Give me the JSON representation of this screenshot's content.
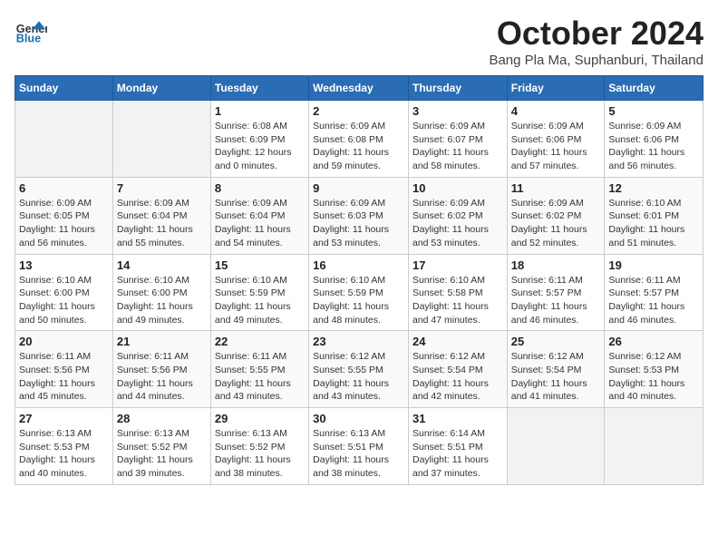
{
  "logo": {
    "general": "General",
    "blue": "Blue"
  },
  "header": {
    "month": "October 2024",
    "location": "Bang Pla Ma, Suphanburi, Thailand"
  },
  "weekdays": [
    "Sunday",
    "Monday",
    "Tuesday",
    "Wednesday",
    "Thursday",
    "Friday",
    "Saturday"
  ],
  "weeks": [
    [
      {
        "day": "",
        "info": ""
      },
      {
        "day": "",
        "info": ""
      },
      {
        "day": "1",
        "info": "Sunrise: 6:08 AM\nSunset: 6:09 PM\nDaylight: 12 hours and 0 minutes."
      },
      {
        "day": "2",
        "info": "Sunrise: 6:09 AM\nSunset: 6:08 PM\nDaylight: 11 hours and 59 minutes."
      },
      {
        "day": "3",
        "info": "Sunrise: 6:09 AM\nSunset: 6:07 PM\nDaylight: 11 hours and 58 minutes."
      },
      {
        "day": "4",
        "info": "Sunrise: 6:09 AM\nSunset: 6:06 PM\nDaylight: 11 hours and 57 minutes."
      },
      {
        "day": "5",
        "info": "Sunrise: 6:09 AM\nSunset: 6:06 PM\nDaylight: 11 hours and 56 minutes."
      }
    ],
    [
      {
        "day": "6",
        "info": "Sunrise: 6:09 AM\nSunset: 6:05 PM\nDaylight: 11 hours and 56 minutes."
      },
      {
        "day": "7",
        "info": "Sunrise: 6:09 AM\nSunset: 6:04 PM\nDaylight: 11 hours and 55 minutes."
      },
      {
        "day": "8",
        "info": "Sunrise: 6:09 AM\nSunset: 6:04 PM\nDaylight: 11 hours and 54 minutes."
      },
      {
        "day": "9",
        "info": "Sunrise: 6:09 AM\nSunset: 6:03 PM\nDaylight: 11 hours and 53 minutes."
      },
      {
        "day": "10",
        "info": "Sunrise: 6:09 AM\nSunset: 6:02 PM\nDaylight: 11 hours and 53 minutes."
      },
      {
        "day": "11",
        "info": "Sunrise: 6:09 AM\nSunset: 6:02 PM\nDaylight: 11 hours and 52 minutes."
      },
      {
        "day": "12",
        "info": "Sunrise: 6:10 AM\nSunset: 6:01 PM\nDaylight: 11 hours and 51 minutes."
      }
    ],
    [
      {
        "day": "13",
        "info": "Sunrise: 6:10 AM\nSunset: 6:00 PM\nDaylight: 11 hours and 50 minutes."
      },
      {
        "day": "14",
        "info": "Sunrise: 6:10 AM\nSunset: 6:00 PM\nDaylight: 11 hours and 49 minutes."
      },
      {
        "day": "15",
        "info": "Sunrise: 6:10 AM\nSunset: 5:59 PM\nDaylight: 11 hours and 49 minutes."
      },
      {
        "day": "16",
        "info": "Sunrise: 6:10 AM\nSunset: 5:59 PM\nDaylight: 11 hours and 48 minutes."
      },
      {
        "day": "17",
        "info": "Sunrise: 6:10 AM\nSunset: 5:58 PM\nDaylight: 11 hours and 47 minutes."
      },
      {
        "day": "18",
        "info": "Sunrise: 6:11 AM\nSunset: 5:57 PM\nDaylight: 11 hours and 46 minutes."
      },
      {
        "day": "19",
        "info": "Sunrise: 6:11 AM\nSunset: 5:57 PM\nDaylight: 11 hours and 46 minutes."
      }
    ],
    [
      {
        "day": "20",
        "info": "Sunrise: 6:11 AM\nSunset: 5:56 PM\nDaylight: 11 hours and 45 minutes."
      },
      {
        "day": "21",
        "info": "Sunrise: 6:11 AM\nSunset: 5:56 PM\nDaylight: 11 hours and 44 minutes."
      },
      {
        "day": "22",
        "info": "Sunrise: 6:11 AM\nSunset: 5:55 PM\nDaylight: 11 hours and 43 minutes."
      },
      {
        "day": "23",
        "info": "Sunrise: 6:12 AM\nSunset: 5:55 PM\nDaylight: 11 hours and 43 minutes."
      },
      {
        "day": "24",
        "info": "Sunrise: 6:12 AM\nSunset: 5:54 PM\nDaylight: 11 hours and 42 minutes."
      },
      {
        "day": "25",
        "info": "Sunrise: 6:12 AM\nSunset: 5:54 PM\nDaylight: 11 hours and 41 minutes."
      },
      {
        "day": "26",
        "info": "Sunrise: 6:12 AM\nSunset: 5:53 PM\nDaylight: 11 hours and 40 minutes."
      }
    ],
    [
      {
        "day": "27",
        "info": "Sunrise: 6:13 AM\nSunset: 5:53 PM\nDaylight: 11 hours and 40 minutes."
      },
      {
        "day": "28",
        "info": "Sunrise: 6:13 AM\nSunset: 5:52 PM\nDaylight: 11 hours and 39 minutes."
      },
      {
        "day": "29",
        "info": "Sunrise: 6:13 AM\nSunset: 5:52 PM\nDaylight: 11 hours and 38 minutes."
      },
      {
        "day": "30",
        "info": "Sunrise: 6:13 AM\nSunset: 5:51 PM\nDaylight: 11 hours and 38 minutes."
      },
      {
        "day": "31",
        "info": "Sunrise: 6:14 AM\nSunset: 5:51 PM\nDaylight: 11 hours and 37 minutes."
      },
      {
        "day": "",
        "info": ""
      },
      {
        "day": "",
        "info": ""
      }
    ]
  ]
}
